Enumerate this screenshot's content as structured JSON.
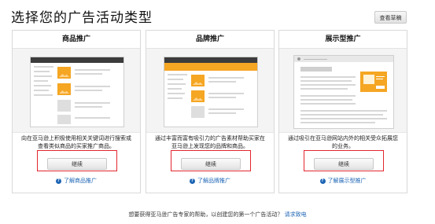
{
  "page_title": "选择您的广告活动类型",
  "draft_button": "查看草稿",
  "cards": [
    {
      "title": "商品推广",
      "desc": "向在亚马逊上积极使用相关关键词进行搜索或查看类似商品的买家推广商品。",
      "button": "继续",
      "learn": "了解商品推广"
    },
    {
      "title": "品牌推广",
      "desc": "通过丰富而富有吸引力的广告素材帮助买家在亚马逊上发现您的品牌和商品。",
      "button": "继续",
      "learn": "了解品牌推广"
    },
    {
      "title": "展示型推广",
      "desc": "通过吸引在亚马逊网站内外的相关受众拓展您的业务。",
      "button": "继续",
      "learn": "了解展示型推广"
    }
  ],
  "footer": {
    "text": "想要获得亚马逊广告专家的帮助，以创建您的第一个广告活动？",
    "link": "请求致电"
  },
  "colors": {
    "highlight_border": "#e3262e",
    "link": "#1d65b5",
    "accent": "#f5a623"
  },
  "icons": {
    "help": "question-circle-icon"
  }
}
